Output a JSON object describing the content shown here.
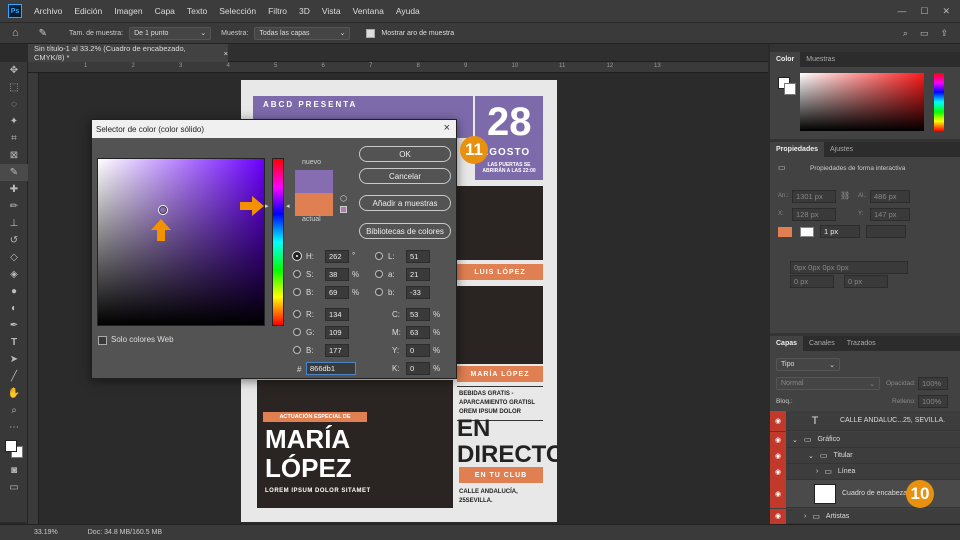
{
  "menubar": {
    "logo": "Ps",
    "items": [
      "Archivo",
      "Edición",
      "Imagen",
      "Capa",
      "Texto",
      "Selección",
      "Filtro",
      "3D",
      "Vista",
      "Ventana",
      "Ayuda"
    ]
  },
  "options": {
    "sample_size_label": "Tam. de muestra:",
    "sample_size_value": "De 1 punto",
    "sample_label": "Muestra:",
    "sample_value": "Todas las capas",
    "show_ring_label": "Mostrar aro de muestra"
  },
  "doc_tab": {
    "title": "Sin título-1 al 33.2% (Cuadro de encabezado, CMYK/8) *",
    "close": "×"
  },
  "ruler_numbers": [
    "1",
    "2",
    "3",
    "4",
    "5",
    "6",
    "7",
    "8",
    "9",
    "10",
    "11",
    "12",
    "13"
  ],
  "status": {
    "zoom": "33.19%",
    "doc": "Doc: 34.8 MB/160.5 MB"
  },
  "poster": {
    "header": "ABCD PRESENTA",
    "day": "28",
    "month": "AGOSTO",
    "doors": "LAS PUERTAS SE\nABRIRÁN A LAS 22:00",
    "artist2": "LUIS LÓPEZ",
    "artist3": "MARÍA LÓPEZ",
    "drinks": "BEBIDAS GRATIS -\nAPARCAMIENTO GRATISL\nOREM IPSUM DOLOR",
    "live": "EN\nDIRECTO",
    "club": "EN TU CLUB",
    "address": "CALLE ANDALUCÍA,\n25SEVILLA.",
    "special": "ACTUACIÓN ESPECIAL DE",
    "name1": "MARÍA",
    "name2": "LÓPEZ",
    "lorem": "LOREM IPSUM DOLOR SITAMET"
  },
  "dialog": {
    "title": "Selector de color (color sólido)",
    "close": "×",
    "new_label": "nuevo",
    "current_label": "actual",
    "ok": "OK",
    "cancel": "Cancelar",
    "add_swatches": "Añadir a muestras",
    "libraries": "Bibliotecas de colores",
    "web_only": "Solo colores Web",
    "hsb": [
      {
        "k": "H:",
        "v": "262",
        "u": "°"
      },
      {
        "k": "S:",
        "v": "38",
        "u": "%"
      },
      {
        "k": "B:",
        "v": "69",
        "u": "%"
      }
    ],
    "rgb": [
      {
        "k": "R:",
        "v": "134"
      },
      {
        "k": "G:",
        "v": "109"
      },
      {
        "k": "B:",
        "v": "177"
      }
    ],
    "lab": [
      {
        "k": "L:",
        "v": "51"
      },
      {
        "k": "a:",
        "v": "21"
      },
      {
        "k": "b:",
        "v": "-33"
      }
    ],
    "cmyk": [
      {
        "k": "C:",
        "v": "53",
        "u": "%"
      },
      {
        "k": "M:",
        "v": "63",
        "u": "%"
      },
      {
        "k": "Y:",
        "v": "0",
        "u": "%"
      },
      {
        "k": "K:",
        "v": "0",
        "u": "%"
      }
    ],
    "hex_label": "#",
    "hex": "866db1",
    "new_color": "#866db1",
    "current_color": "#e07f52"
  },
  "callouts": {
    "c11": "11",
    "c10": "10"
  },
  "color_panel": {
    "tabs": [
      "Color",
      "Muestras"
    ]
  },
  "properties_panel": {
    "tabs": [
      "Propiedades",
      "Ajustes"
    ],
    "subtitle": "Propiedades de forma interactiva",
    "w_label": "An.:",
    "w_value": "1301 px",
    "h_label": "Al.:",
    "h_value": "486 px",
    "x_label": "X:",
    "x_value": "128 px",
    "y_label": "Y:",
    "y_value": "147 px",
    "stroke_value": "1 px",
    "radius_value": "0px 0px 0px 0px",
    "r1": "0 px",
    "r2": "0 px"
  },
  "layers_panel": {
    "tabs": [
      "Capas",
      "Canales",
      "Trazados"
    ],
    "filter": "Tipo",
    "blend": "Normal",
    "opacity_label": "Opacidad:",
    "opacity_value": "100%",
    "lock_label": "Bloq.:",
    "fill_label": "Relleno:",
    "fill_value": "100%",
    "layers": [
      "CALLE ANDALUC...25, SEVILLA.",
      "Gráfico",
      "Titular",
      "Línea",
      "Cuadro de encabezado",
      "Artistas"
    ]
  },
  "colors": {
    "accent": "#e07f52",
    "purple": "#7d6aab",
    "callout": "#e8910f"
  }
}
